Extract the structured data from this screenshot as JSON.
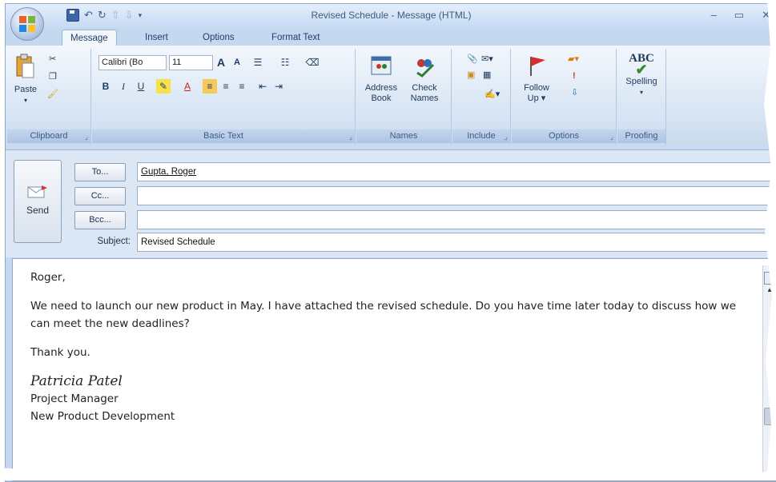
{
  "window": {
    "title": "Revised Schedule - Message (HTML)"
  },
  "tabs": [
    "Message",
    "Insert",
    "Options",
    "Format Text"
  ],
  "ribbon": {
    "clipboard": {
      "paste": "Paste",
      "label": "Clipboard"
    },
    "basic_text": {
      "font": "Calibri (Bo",
      "size": "11",
      "bold": "B",
      "italic": "I",
      "underline": "U",
      "grow": "A",
      "shrink": "A",
      "label": "Basic Text"
    },
    "names": {
      "address_book": [
        "Address",
        "Book"
      ],
      "check_names": [
        "Check",
        "Names"
      ],
      "label": "Names"
    },
    "include": {
      "label": "Include"
    },
    "options": {
      "follow_up": [
        "Follow",
        "Up"
      ],
      "label": "Options"
    },
    "proofing": {
      "spelling": "Spelling",
      "abc": "ABC",
      "label": "Proofing"
    }
  },
  "header": {
    "send": "Send",
    "to_button": "To...",
    "cc_button": "Cc...",
    "bcc_button": "Bcc...",
    "to_value": "Gupta, Roger",
    "cc_value": "",
    "bcc_value": "",
    "subject_label": "Subject:",
    "subject_value": "Revised Schedule"
  },
  "body": {
    "greeting": "Roger,",
    "paragraph": "We need to launch our new product in May. I have attached the revised schedule. Do you have time later today to discuss how we can meet the new deadlines?",
    "closing": "Thank you.",
    "signature": "Patricia Patel",
    "title": "Project Manager",
    "department": "New Product Development"
  }
}
